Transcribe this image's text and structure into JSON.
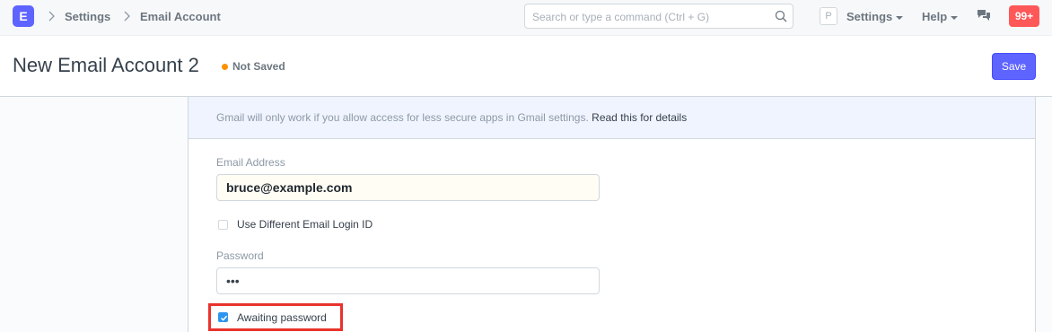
{
  "navbar": {
    "logo": "E",
    "breadcrumbs": [
      "Settings",
      "Email Account"
    ],
    "search_placeholder": "Search or type a command (Ctrl + G)",
    "avatar": "P",
    "menu_settings": "Settings",
    "menu_help": "Help",
    "notification_count": "99+"
  },
  "page": {
    "title": "New Email Account 2",
    "status": "Not Saved",
    "save_label": "Save"
  },
  "form": {
    "alert_text": "Gmail will only work if you allow access for less secure apps in Gmail settings.",
    "alert_link": "Read this for details",
    "email_label": "Email Address",
    "email_value": "bruce@example.com",
    "use_different_login_label": "Use Different Email Login ID",
    "use_different_login_checked": false,
    "password_label": "Password",
    "password_value": "•••",
    "awaiting_password_label": "Awaiting password",
    "awaiting_password_checked": true
  },
  "colors": {
    "accent": "#5e64ff",
    "status_dot": "#ff9100",
    "badge": "#ff5858",
    "checkbox": "#2d95f0",
    "highlight": "#e8332c"
  }
}
